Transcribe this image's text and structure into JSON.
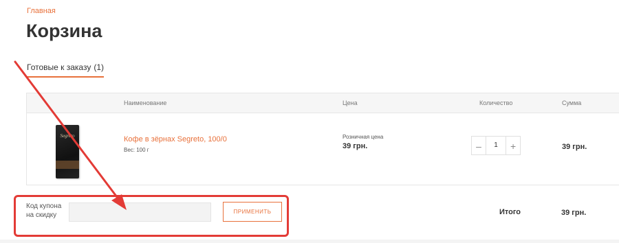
{
  "breadcrumb": {
    "home": "Главная"
  },
  "page": {
    "title": "Корзина"
  },
  "tabs": {
    "ready": {
      "label": "Готовые к заказу",
      "count": "(1)"
    }
  },
  "table": {
    "headers": {
      "name": "Наименование",
      "price": "Цена",
      "quantity": "Количество",
      "sum": "Сумма"
    },
    "items": [
      {
        "image_brand": "Segreto",
        "name": "Кофе в зёрнах Segreto, 100/0",
        "weight": "Вес: 100 г",
        "price_label": "Розничная цена",
        "price": "39 грн.",
        "quantity": "1",
        "minus_symbol": "–",
        "plus_symbol": "+",
        "sum": "39 грн."
      }
    ]
  },
  "coupon": {
    "label": "Код купона на скидку",
    "input_value": "",
    "apply_label": "ПРИМЕНИТЬ"
  },
  "total": {
    "label": "Итого",
    "value": "39 грн."
  },
  "colors": {
    "accent": "#e8703a",
    "annotation": "#e33b36"
  }
}
